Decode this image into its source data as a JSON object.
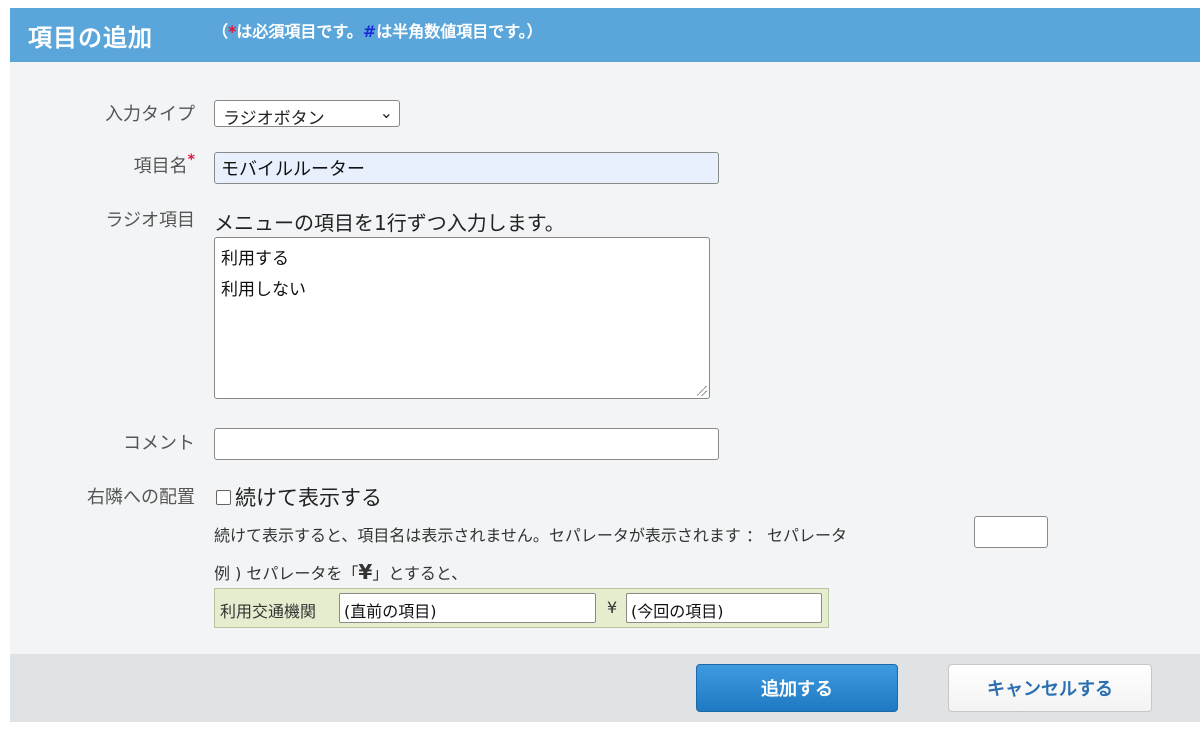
{
  "header": {
    "title": "項目の追加",
    "note_open": "（",
    "note_star": "*",
    "note_mid": "は必須項目です。",
    "note_hash": "#",
    "note_end": "は半角数値項目です。）"
  },
  "form": {
    "input_type": {
      "label": "入力タイプ",
      "value": "ラジオボタン"
    },
    "item_name": {
      "label": "項目名",
      "required_mark": "*",
      "value": "モバイルルーター"
    },
    "radio_items": {
      "label": "ラジオ項目",
      "hint": "メニューの項目を1行ずつ入力します。",
      "lines": [
        "利用する",
        "利用しない"
      ]
    },
    "comment": {
      "label": "コメント",
      "value": ""
    },
    "placement": {
      "label": "右隣への配置",
      "checkbox_label": "続けて表示する",
      "checked": false,
      "description": "続けて表示すると、項目名は表示されません。セパレータが表示されます ： セパレータ",
      "separator_value": "",
      "example_intro": "例 ) セパレータを「",
      "example_yen": "¥",
      "example_outro": "」とすると、",
      "example": {
        "label": "利用交通機関",
        "first_value": "(直前の項目)",
        "yen": "¥",
        "second_value": "(今回の項目)"
      }
    }
  },
  "buttons": {
    "add": "追加する",
    "cancel": "キャンセルする"
  }
}
